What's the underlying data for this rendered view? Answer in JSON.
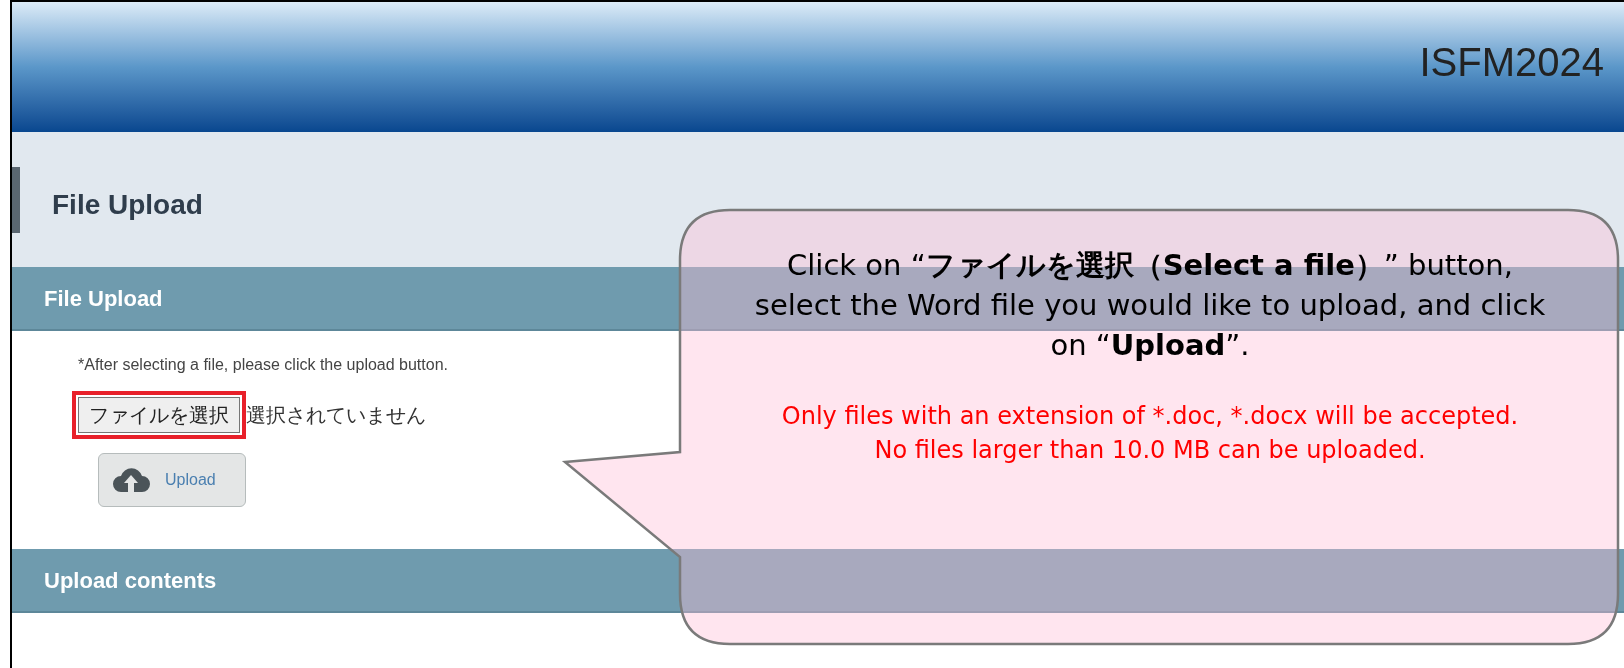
{
  "header": {
    "site_title": "ISFM2024"
  },
  "page_title": "File Upload",
  "panels": [
    {
      "title": "File Upload"
    },
    {
      "title": "Upload contents"
    }
  ],
  "upload_form": {
    "note": "*After selecting a file, please click the upload button.",
    "choose_button": "ファイルを選択",
    "file_status": "選択されていません",
    "highlighted": true,
    "upload_button": "Upload"
  },
  "callout": {
    "instruction": "Click on “**ファイルを選択（Select a file）**” button, select the Word file you would like to upload, and click on “**Upload**”.",
    "warnings": [
      "Only files with an extension of *.doc, *.docx will be accepted.",
      "No files larger than 10.0 MB can be uploaded."
    ]
  }
}
